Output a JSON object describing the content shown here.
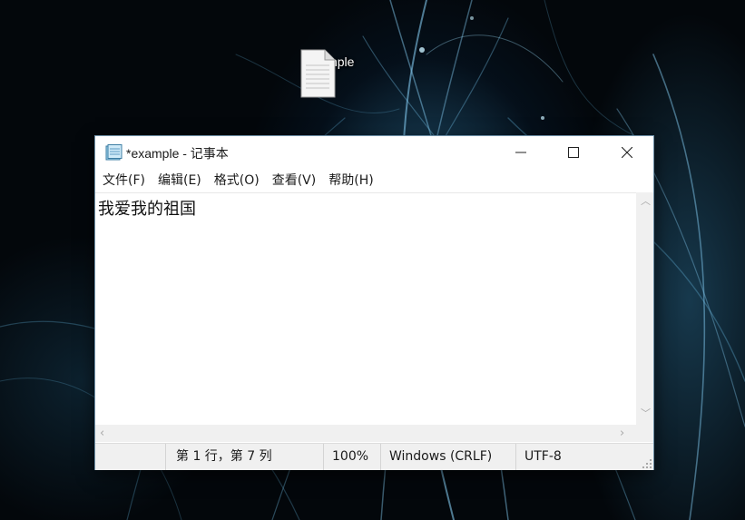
{
  "desktop": {
    "icon_label": "example",
    "icon": "text-file-icon"
  },
  "window": {
    "title": "*example - 记事本",
    "app_icon": "notepad-icon",
    "controls": {
      "minimize": "minimize-icon",
      "maximize": "maximize-icon",
      "close": "close-icon"
    }
  },
  "menu": {
    "items": [
      "文件(F)",
      "编辑(E)",
      "格式(O)",
      "查看(V)",
      "帮助(H)"
    ]
  },
  "editor": {
    "content": "我爱我的祖国"
  },
  "statusbar": {
    "position": "第 1 行，第 7 列",
    "zoom": "100%",
    "line_ending": "Windows (CRLF)",
    "encoding": "UTF-8"
  },
  "colors": {
    "window_bg": "#ffffff",
    "chrome_bg": "#f0f0f0",
    "close_hover": "#e81123"
  }
}
